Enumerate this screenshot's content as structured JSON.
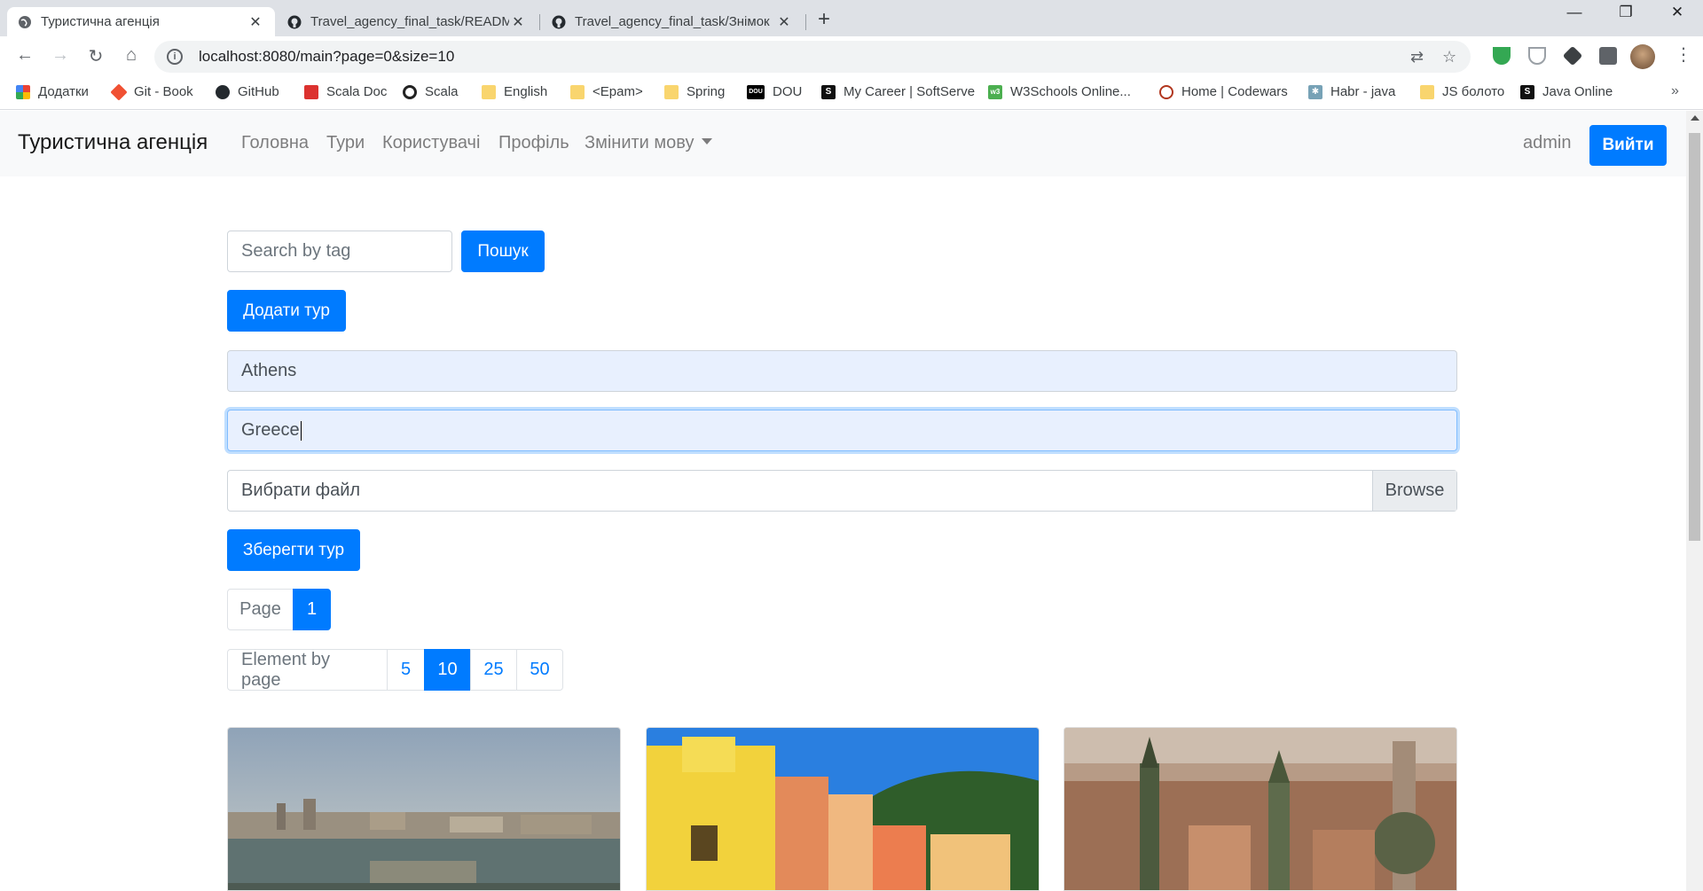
{
  "browser": {
    "tabs": [
      {
        "title": "Туристична агенція",
        "icon": "globe-icon",
        "active": true
      },
      {
        "title": "Travel_agency_final_task/READM",
        "icon": "github-icon",
        "active": false
      },
      {
        "title": "Travel_agency_final_task/Знімок",
        "icon": "github-icon",
        "active": false
      }
    ],
    "url": "localhost:8080/main?page=0&size=10",
    "bookmarks": [
      {
        "label": "Додатки",
        "icon": "apps-grid-icon",
        "color": "#ea4335"
      },
      {
        "label": "Git - Book",
        "icon": "git-icon",
        "color": "#f05133"
      },
      {
        "label": "GitHub",
        "icon": "github-icon",
        "color": "#24292e"
      },
      {
        "label": "Scala Doc",
        "icon": "scala-icon",
        "color": "#dc322f"
      },
      {
        "label": "Scala",
        "icon": "scala-circle-icon",
        "color": "#222222"
      },
      {
        "label": "English",
        "icon": "folder-icon",
        "color": "#f9d56e"
      },
      {
        "label": "<Epam>",
        "icon": "folder-icon",
        "color": "#f9d56e"
      },
      {
        "label": "Spring",
        "icon": "folder-icon",
        "color": "#f9d56e"
      },
      {
        "label": "DOU",
        "icon": "dou-icon",
        "color": "#000000"
      },
      {
        "label": "My Career | SoftServe",
        "icon": "softserve-icon",
        "color": "#111111"
      },
      {
        "label": "W3Schools Online...",
        "icon": "w3schools-icon",
        "color": "#4caf50"
      },
      {
        "label": "Home | Codewars",
        "icon": "codewars-icon",
        "color": "#b1361e"
      },
      {
        "label": "Habr - java",
        "icon": "habr-icon",
        "color": "#77a2b6"
      },
      {
        "label": "JS болото",
        "icon": "folder-icon",
        "color": "#f9d56e"
      },
      {
        "label": "Java Online",
        "icon": "java-online-icon",
        "color": "#111111"
      }
    ]
  },
  "navbar": {
    "brand": "Туристична агенція",
    "links": [
      "Головна",
      "Тури",
      "Користувачі",
      "Профіль"
    ],
    "language_dropdown": "Змінити мову",
    "username": "admin",
    "logout": "Вийти"
  },
  "search": {
    "placeholder": "Search by tag",
    "button": "Пошук"
  },
  "add_tour_button": "Додати тур",
  "tour_form": {
    "city_value": "Athens",
    "country_value": "Greece",
    "file_label": "Вибрати файл",
    "browse_label": "Browse",
    "save_button": "Зберегти тур"
  },
  "pagination": {
    "page_label": "Page",
    "pages": [
      "1"
    ],
    "active_page": "1"
  },
  "page_size": {
    "label": "Element by page",
    "options": [
      "5",
      "10",
      "25",
      "50"
    ],
    "active": "10"
  },
  "colors": {
    "primary": "#007bff",
    "navbar_bg": "#f8f9fa"
  }
}
